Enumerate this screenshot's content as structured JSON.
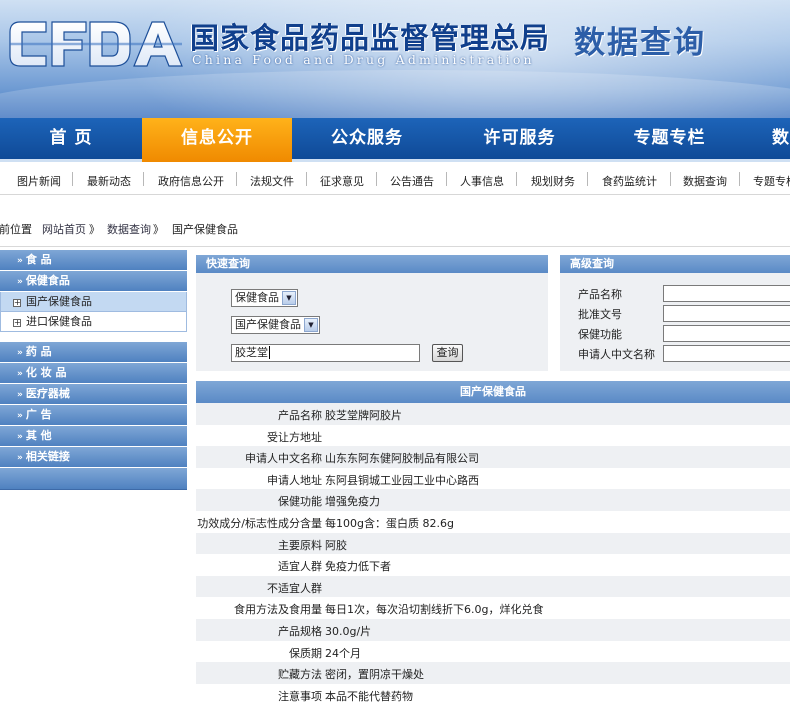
{
  "header": {
    "logo_text": "CFDA",
    "title_cn": "国家食品药品监督管理总局",
    "title_en": "China Food and Drug Administration",
    "section_title": "数据查询",
    "brand_color": "#1a4f9e"
  },
  "main_nav": {
    "items": [
      {
        "label": "首  页"
      },
      {
        "label": "信息公开",
        "active": true
      },
      {
        "label": "公众服务"
      },
      {
        "label": "许可服务"
      },
      {
        "label": "专题专栏"
      },
      {
        "label": "数"
      }
    ],
    "active_color": "#f59a0c"
  },
  "sub_nav": {
    "items": [
      "图片新闻",
      "最新动态",
      "政府信息公开",
      "法规文件",
      "征求意见",
      "公告通告",
      "人事信息",
      "规划财务",
      "食药监统计",
      "数据查询",
      "专题专栏"
    ]
  },
  "breadcrumb": {
    "prefix": "当前位置",
    "items": [
      "网站首页",
      "数据查询",
      "国产保健食品"
    ],
    "separator": "》"
  },
  "left_menu": {
    "categories": [
      {
        "label": "食   品",
        "children": []
      },
      {
        "label": "保健食品",
        "children": [
          {
            "label": "国产保健食品",
            "selected": true
          },
          {
            "label": "进口保健食品",
            "selected": false
          }
        ]
      },
      {
        "label": "药   品",
        "children": []
      },
      {
        "label": "化 妆 品",
        "children": []
      },
      {
        "label": "医疗器械",
        "children": []
      },
      {
        "label": "广   告",
        "children": []
      },
      {
        "label": "其   他",
        "children": []
      },
      {
        "label": "相关链接",
        "children": []
      }
    ]
  },
  "quick_search": {
    "title": "快速查询",
    "category_select": "保健食品",
    "subcategory_select": "国产保健食品",
    "keyword_value": "胶芝堂",
    "search_button": "查询"
  },
  "advanced_search": {
    "title": "高级查询",
    "fields": [
      "产品名称",
      "批准文号",
      "保健功能",
      "申请人中文名称"
    ]
  },
  "detail": {
    "title": "国产保健食品",
    "rows": [
      {
        "key": "产品名称",
        "value": "胶芝堂牌阿胶片"
      },
      {
        "key": "受让方地址",
        "value": ""
      },
      {
        "key": "申请人中文名称",
        "value": "山东东阿东健阿胶制品有限公司"
      },
      {
        "key": "申请人地址",
        "value": "东阿县铜城工业园工业中心路西"
      },
      {
        "key": "保健功能",
        "value": "增强免疫力"
      },
      {
        "key": "功效成分/标志性成分含量",
        "value": "每100g含：蛋白质 82.6g"
      },
      {
        "key": "主要原料",
        "value": "阿胶"
      },
      {
        "key": "适宜人群",
        "value": "免疫力低下者"
      },
      {
        "key": "不适宜人群",
        "value": ""
      },
      {
        "key": "食用方法及食用量",
        "value": "每日1次，每次沿切割线折下6.0g，烊化兑食"
      },
      {
        "key": "产品规格",
        "value": "30.0g/片"
      },
      {
        "key": "保质期",
        "value": "24个月"
      },
      {
        "key": "贮藏方法",
        "value": "密闭，置阴凉干燥处"
      },
      {
        "key": "注意事项",
        "value": "本品不能代替药物"
      }
    ]
  }
}
